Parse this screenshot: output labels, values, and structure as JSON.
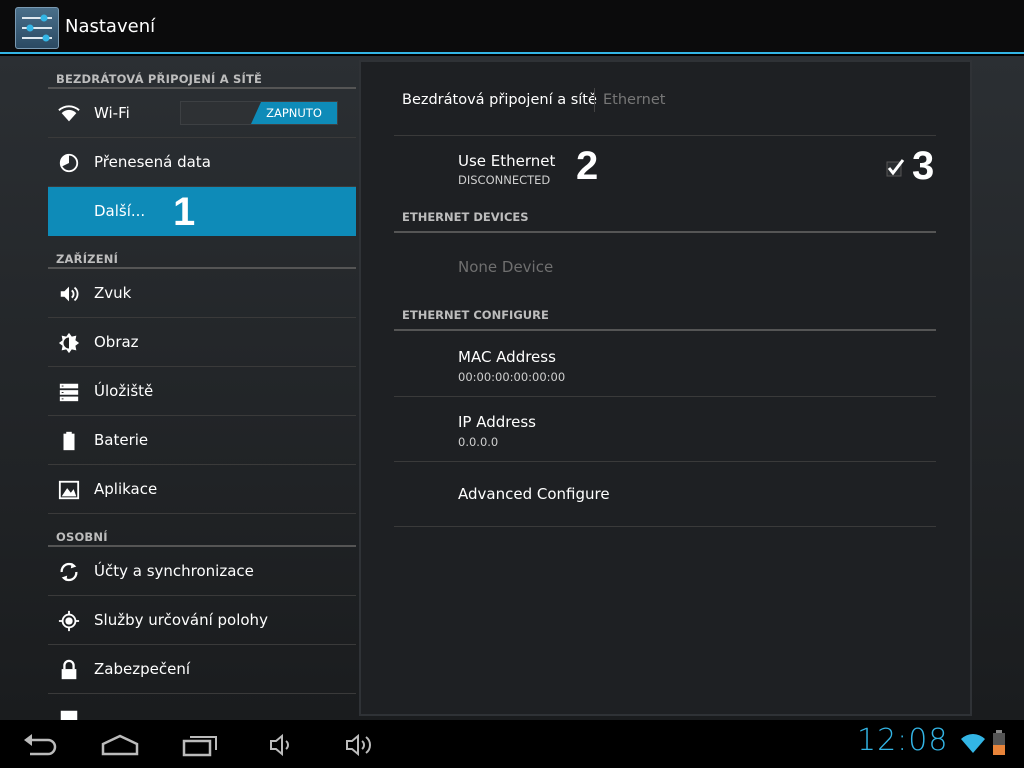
{
  "action_bar": {
    "title": "Nastavení"
  },
  "sidebar": {
    "categories": [
      "BEZDRÁTOVÁ PŘIPOJENÍ A SÍTĚ",
      "ZAŘÍZENÍ",
      "OSOBNÍ"
    ],
    "items": [
      {
        "label": "Wi-Fi",
        "icon": "wifi-icon",
        "toggle": "ZAPNUTO"
      },
      {
        "label": "Přenesená data",
        "icon": "data-usage-icon"
      },
      {
        "label": "Další...",
        "selected": true,
        "annotation": "1"
      },
      {
        "label": "Zvuk",
        "icon": "speaker-icon"
      },
      {
        "label": "Obraz",
        "icon": "brightness-icon"
      },
      {
        "label": "Úložiště",
        "icon": "storage-icon"
      },
      {
        "label": "Baterie",
        "icon": "battery-icon"
      },
      {
        "label": "Aplikace",
        "icon": "apps-icon"
      },
      {
        "label": "Účty a synchronizace",
        "icon": "sync-icon"
      },
      {
        "label": "Služby určování polohy",
        "icon": "location-icon"
      },
      {
        "label": "Zabezpečení",
        "icon": "lock-icon"
      }
    ]
  },
  "panel": {
    "breadcrumb": {
      "main": "Bezdrátová připojení a sítě",
      "sub": "Ethernet"
    },
    "use_ethernet": {
      "title": "Use Ethernet",
      "summary": "DISCONNECTED",
      "checked": true,
      "annotation_title": "2",
      "annotation_check": "3"
    },
    "devices_header": "ETHERNET DEVICES",
    "none_device": "None Device",
    "config_header": "ETHERNET CONFIGURE",
    "mac": {
      "title": "MAC Address",
      "value": "00:00:00:00:00:00"
    },
    "ip": {
      "title": "IP Address",
      "value": "0.0.0.0"
    },
    "advanced": {
      "title": "Advanced Configure"
    }
  },
  "status": {
    "clock": "12:08"
  },
  "colors": {
    "accent": "#33b5e5",
    "selected": "#0e8bb8"
  }
}
